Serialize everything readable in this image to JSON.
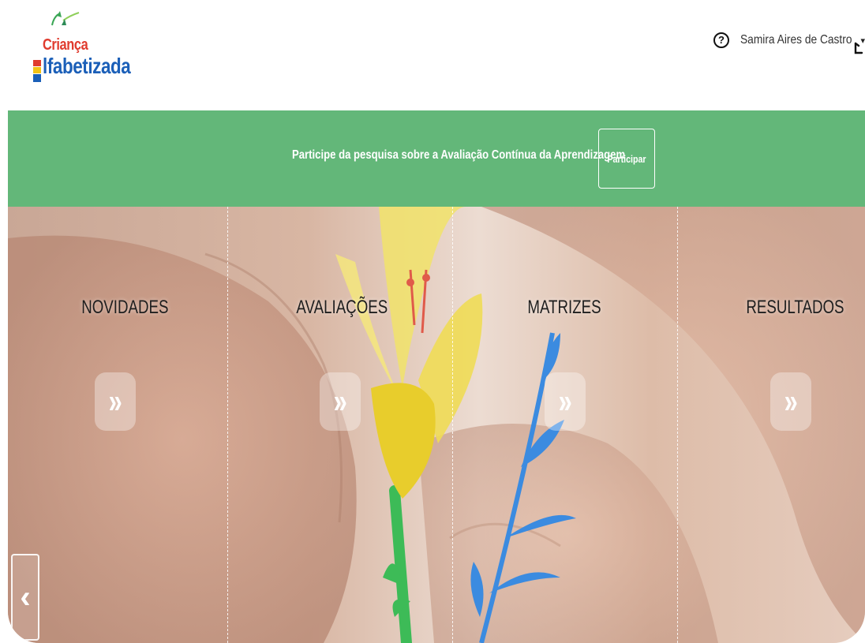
{
  "header": {
    "logo": {
      "line1": "Criança",
      "line2": "lfabetizada"
    },
    "help_glyph": "?",
    "user_name": "Samira Aires de Castro",
    "caret": "▾",
    "icons": {
      "help": "help-circle-icon",
      "caret": "caret-down-icon",
      "logout": "logout-icon"
    }
  },
  "banner": {
    "text": "Participe da pesquisa sobre a Avaliação Contínua da Aprendizagem",
    "button_label": "Participar",
    "color": "#63b779"
  },
  "hero": {
    "sections": [
      {
        "title": "NOVIDADES",
        "chevron": "»"
      },
      {
        "title": "AVALIAÇÕES",
        "chevron": "»"
      },
      {
        "title": "MATRIZES",
        "chevron": "»"
      },
      {
        "title": "RESULTADOS",
        "chevron": "»"
      }
    ],
    "prev_glyph": "‹"
  },
  "colors": {
    "logo_red": "#e03b2e",
    "logo_blue": "#1b5fb8",
    "banner_green": "#63b779"
  }
}
